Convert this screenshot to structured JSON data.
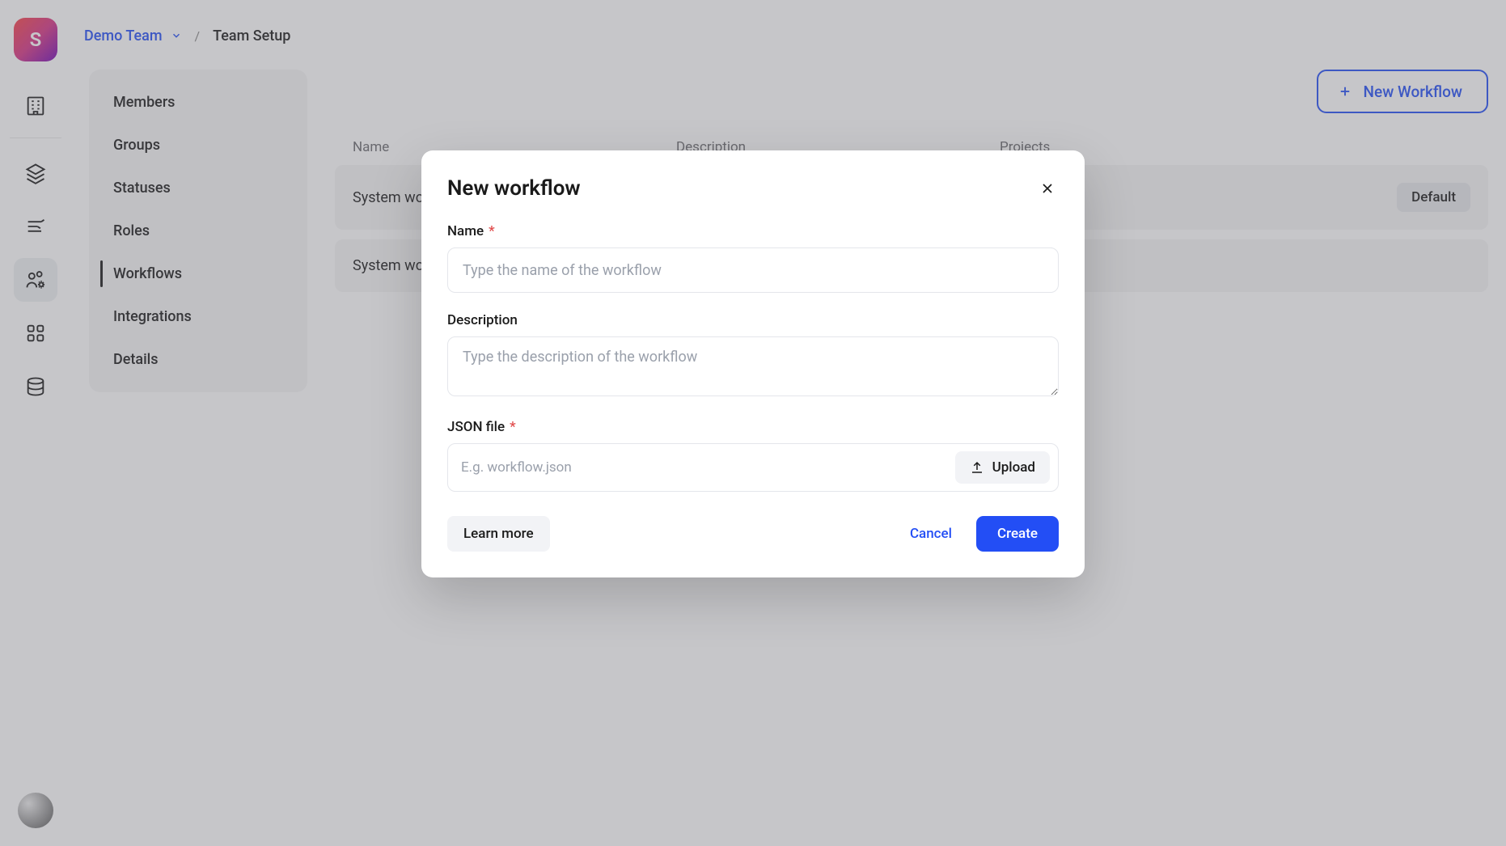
{
  "breadcrumb": {
    "team": "Demo Team",
    "page": "Team Setup"
  },
  "sidebar": {
    "items": [
      {
        "label": "Members"
      },
      {
        "label": "Groups"
      },
      {
        "label": "Statuses"
      },
      {
        "label": "Roles"
      },
      {
        "label": "Workflows"
      },
      {
        "label": "Integrations"
      },
      {
        "label": "Details"
      }
    ]
  },
  "actions": {
    "new_workflow": "New Workflow"
  },
  "table": {
    "headers": {
      "name": "Name",
      "description": "Description",
      "projects": "Projects"
    },
    "rows": [
      {
        "name": "System workflow",
        "default_badge": "Default"
      },
      {
        "name": "System workflow"
      }
    ]
  },
  "modal": {
    "title": "New workflow",
    "name_label": "Name",
    "name_placeholder": "Type the name of the workflow",
    "desc_label": "Description",
    "desc_placeholder": "Type the description of the workflow",
    "json_label": "JSON file",
    "json_placeholder": "E.g. workflow.json",
    "upload": "Upload",
    "learn_more": "Learn more",
    "cancel": "Cancel",
    "create": "Create"
  },
  "logo_letter": "S"
}
